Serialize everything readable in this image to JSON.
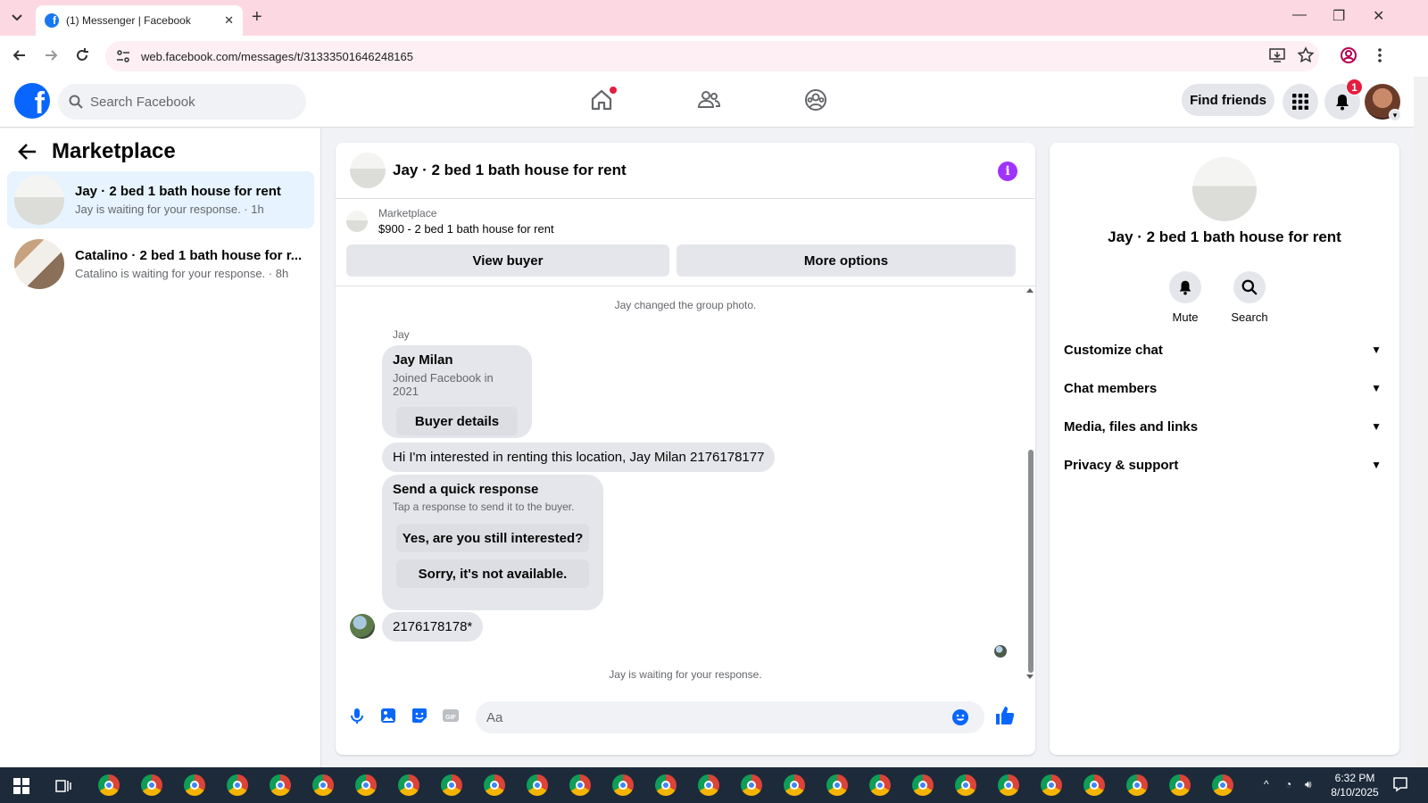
{
  "browser": {
    "tab_title": "(1) Messenger | Facebook",
    "url": "web.facebook.com/messages/t/31333501646248165"
  },
  "header": {
    "search_placeholder": "Search Facebook",
    "find_friends": "Find friends",
    "notification_count": "1",
    "logo_letter": "f"
  },
  "sidebar": {
    "title": "Marketplace",
    "conversations": [
      {
        "name": "Jay · 2 bed 1 bath house for rent",
        "sub": "Jay is waiting for your response. · 1h"
      },
      {
        "name": "Catalino · 2 bed 1 bath house for r...",
        "sub": "Catalino is waiting for your response. · 8h"
      }
    ]
  },
  "chat": {
    "title": "Jay · 2 bed 1 bath house for rent",
    "marketplace_label": "Marketplace",
    "listing": "$900 - 2 bed 1 bath house for rent",
    "view_buyer": "View buyer",
    "more_options": "More options",
    "system_msg_1": "Jay changed the group photo.",
    "sender": "Jay",
    "buyer_card": {
      "name": "Jay Milan",
      "sub": "Joined Facebook in 2021",
      "button": "Buyer details"
    },
    "message_1": "Hi I'm interested in renting this location, Jay Milan 2176178177",
    "quick_response": {
      "title": "Send a quick response",
      "sub": "Tap a response to send it to the buyer.",
      "option_1": "Yes, are you still interested?",
      "option_2": "Sorry, it's not available."
    },
    "message_2": "2176178178*",
    "system_msg_2": "Jay is waiting for your response.",
    "composer_placeholder": "Aa"
  },
  "details": {
    "title": "Jay · 2 bed 1 bath house for rent",
    "mute": "Mute",
    "search": "Search",
    "sections": [
      "Customize chat",
      "Chat members",
      "Media, files and links",
      "Privacy & support"
    ]
  },
  "taskbar": {
    "time": "6:32 PM",
    "date": "8/10/2025"
  },
  "colors": {
    "fb_blue": "#0866ff",
    "messenger_purple": "#a033ff",
    "active_row": "#e7f3ff"
  }
}
